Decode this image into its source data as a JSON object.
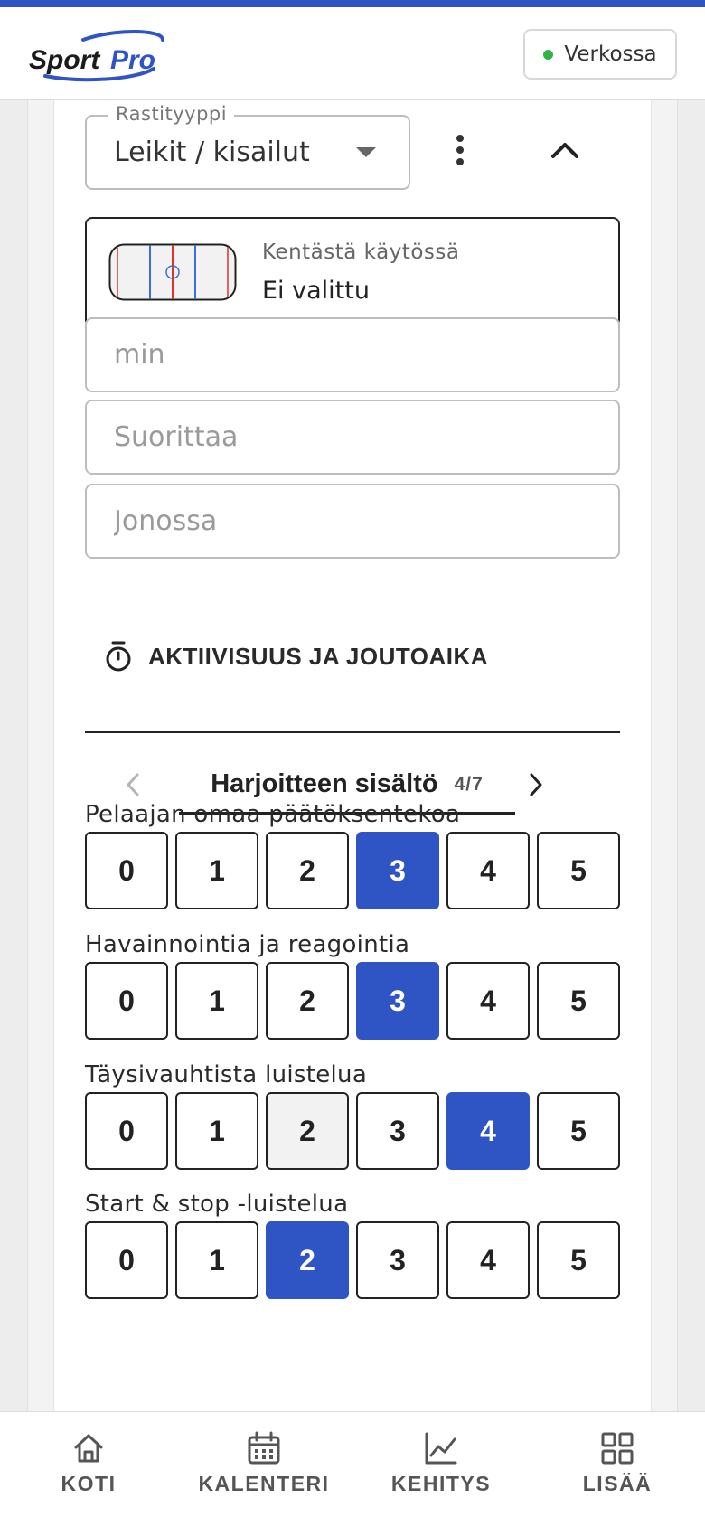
{
  "header": {
    "logo_text_part1": "Sport",
    "logo_text_part2": "Pro",
    "status_label": "Verkossa",
    "status_color": "#2fb344"
  },
  "station": {
    "type_label": "Rastityyppi",
    "type_value": "Leikit / kisailut",
    "more_icon": "more-vertical-icon",
    "collapse_icon": "chevron-up-icon"
  },
  "field": {
    "title": "Kentästä käytössä",
    "value": "Ei valittu"
  },
  "inputs": {
    "minutes_placeholder": "min",
    "performing_placeholder": "Suorittaa",
    "queue_placeholder": "Jonossa"
  },
  "activity": {
    "label": "AKTIIVISUUS JA JOUTOAIKA",
    "icon": "stopwatch-icon"
  },
  "content_tab": {
    "title": "Harjoitteen sisältö",
    "count": "4/7"
  },
  "ratings": [
    {
      "label": "Pelaajan omaa päätöksentekoa",
      "options": [
        "0",
        "1",
        "2",
        "3",
        "4",
        "5"
      ],
      "selected": 3
    },
    {
      "label": "Havainnointia ja reagointia",
      "options": [
        "0",
        "1",
        "2",
        "3",
        "4",
        "5"
      ],
      "selected": 3
    },
    {
      "label": "Täysivauhtista luistelua",
      "options": [
        "0",
        "1",
        "2",
        "3",
        "4",
        "5"
      ],
      "selected": 4
    },
    {
      "label": "Start & stop -luistelua",
      "options": [
        "0",
        "1",
        "2",
        "3",
        "4",
        "5"
      ],
      "selected": 2
    }
  ],
  "bottom_nav": {
    "home": "KOTI",
    "calendar": "KALENTERI",
    "progress": "KEHITYS",
    "more": "LISÄÄ"
  },
  "colors": {
    "accent": "#2f55c4"
  }
}
